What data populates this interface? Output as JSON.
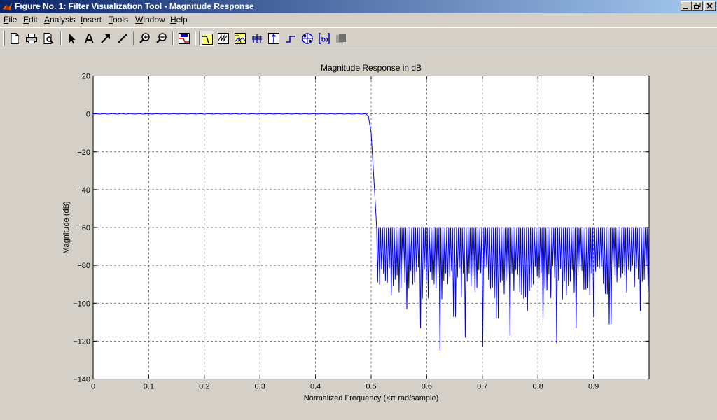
{
  "window": {
    "title": "Figure No. 1: Filter Visualization Tool - Magnitude Response",
    "icon": "matlab-logo-icon",
    "buttons": [
      "minimize-icon",
      "restore-icon",
      "close-icon"
    ]
  },
  "menu": {
    "items": [
      {
        "label": "File",
        "key": "F"
      },
      {
        "label": "Edit",
        "key": "E"
      },
      {
        "label": "Analysis",
        "key": "A"
      },
      {
        "label": "Insert",
        "key": "I"
      },
      {
        "label": "Tools",
        "key": "T"
      },
      {
        "label": "Window",
        "key": "W"
      },
      {
        "label": "Help",
        "key": "H"
      }
    ]
  },
  "toolbar": {
    "buttons": [
      "new-figure-icon",
      "print-icon",
      "print-preview-icon",
      "edit-plot-arrow-icon",
      "insert-text-icon",
      "insert-arrow-icon",
      "insert-line-icon",
      "zoom-in-icon",
      "zoom-out-icon",
      "filter-specs-icon",
      "magnitude-response-icon",
      "phase-response-icon",
      "magnitude-phase-icon",
      "group-delay-icon",
      "impulse-response-icon",
      "step-response-icon",
      "pole-zero-icon",
      "filter-coefficients-icon",
      "filter-info-icon"
    ],
    "active": "magnitude-response-icon"
  },
  "chart_data": {
    "type": "line",
    "title": "Magnitude Response in dB",
    "xlabel": "Normalized Frequency  (×π rad/sample)",
    "ylabel": "Magnitude (dB)",
    "xlim": [
      0,
      1
    ],
    "ylim": [
      -140,
      20
    ],
    "xticks": [
      0,
      0.1,
      0.2,
      0.3,
      0.4,
      0.5,
      0.6,
      0.7,
      0.8,
      0.9
    ],
    "xtick_labels": [
      "0",
      "0.1",
      "0.2",
      "0.3",
      "0.4",
      "0.5",
      "0.6",
      "0.7",
      "0.8",
      "0.9"
    ],
    "yticks": [
      20,
      0,
      -20,
      -40,
      -60,
      -80,
      -100,
      -120,
      -140
    ],
    "ytick_labels": [
      "20",
      "0",
      "−20",
      "−40",
      "−60",
      "−80",
      "−100",
      "−120",
      "−140"
    ],
    "grid": true,
    "line_color": "#0000ff",
    "series": [
      {
        "passband": {
          "x": [
            0,
            0.49
          ],
          "value": 0
        },
        "transition": {
          "x": [
            0.49,
            0.495,
            0.5,
            0.502,
            0.505,
            0.507,
            0.51
          ],
          "y": [
            0,
            -1,
            -10,
            -20,
            -35,
            -45,
            -60
          ]
        },
        "stopband": {
          "x": [
            0.51,
            1.0
          ],
          "peak": -60,
          "nulls": 140,
          "deep_nulls": [
            {
              "x": 0.564,
              "y": -103
            },
            {
              "x": 0.59,
              "y": -113
            },
            {
              "x": 0.623,
              "y": -125
            },
            {
              "x": 0.65,
              "y": -107
            },
            {
              "x": 0.668,
              "y": -118
            },
            {
              "x": 0.7,
              "y": -123
            },
            {
              "x": 0.727,
              "y": -108
            },
            {
              "x": 0.75,
              "y": -117
            },
            {
              "x": 0.78,
              "y": -104
            },
            {
              "x": 0.81,
              "y": -110
            },
            {
              "x": 0.835,
              "y": -121
            },
            {
              "x": 0.87,
              "y": -113
            },
            {
              "x": 0.9,
              "y": -107
            },
            {
              "x": 0.93,
              "y": -111
            },
            {
              "x": 0.985,
              "y": -104
            }
          ]
        }
      }
    ]
  }
}
